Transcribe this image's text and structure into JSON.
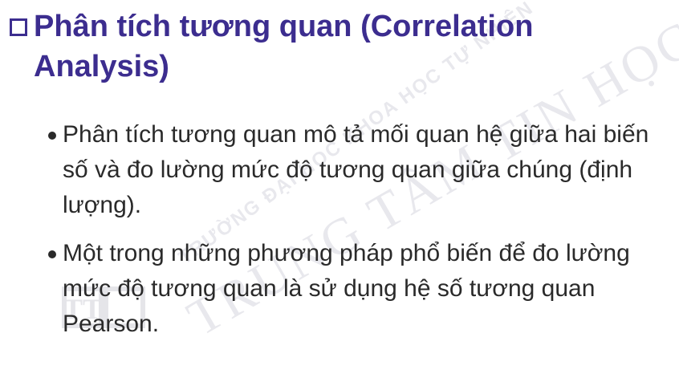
{
  "heading": {
    "text": "Phân tích tương quan (Correlation Analysis)"
  },
  "bullets": [
    {
      "text": "Phân tích tương quan mô tả mối quan hệ giữa hai biến số và đo lường mức độ tương quan giữa chúng (định lượng)."
    },
    {
      "text": "Một trong những phương pháp phổ biến để đo lường mức độ tương quan là sử dụng hệ số tương quan Pearson."
    }
  ],
  "watermark": {
    "line1": "TRƯỜNG ĐẠI HỌC KHOA HỌC TỰ NHIÊN",
    "line2": "TRUNG TÂM TIN HỌC",
    "logo_text": "TT"
  },
  "colors": {
    "heading": "#3c2d8f",
    "body": "#2a2a2a",
    "watermark": "#e9e9ee"
  }
}
